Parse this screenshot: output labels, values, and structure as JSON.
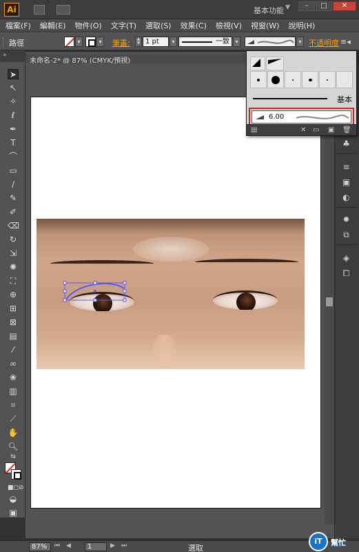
{
  "app": {
    "logo": "Ai",
    "workspace": "基本功能"
  },
  "menu": [
    "檔案(F)",
    "編輯(E)",
    "物件(O)",
    "文字(T)",
    "選取(S)",
    "效果(C)",
    "檢視(V)",
    "視窗(W)",
    "說明(H)"
  ],
  "control_bar": {
    "selection_type": "路徑",
    "stroke_label": "筆畫:",
    "stroke_weight": "1 pt",
    "variable_width_profile": "一致",
    "opacity_label": "不透明度"
  },
  "document": {
    "tab_label": "未命名-2* @ 87% (CMYK/預視)",
    "close_glyph": "×"
  },
  "brush_panel": {
    "basic_label": "基本",
    "selected_brush_size": "6.00"
  },
  "status_bar": {
    "zoom": "87%",
    "artboard_number": "1",
    "status": "選取"
  },
  "watermark": {
    "badge": "iT",
    "text": "幫忙"
  },
  "colors": {
    "accent": "#ff9a00",
    "highlight_box": "#d8201e",
    "path_selection": "#5a5af0"
  }
}
